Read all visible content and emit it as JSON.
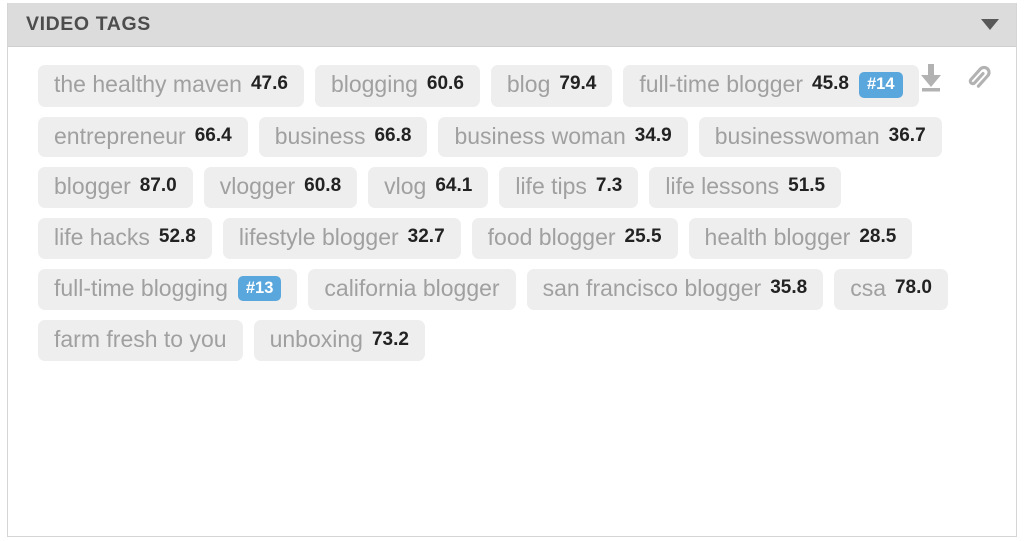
{
  "panel": {
    "title": "VIDEO TAGS",
    "collapse_icon": "chevron-down-icon",
    "collapse_state": "expanded"
  },
  "toolbar": {
    "items": [
      {
        "name": "download-icon",
        "label": "Download"
      },
      {
        "name": "paperclip-icon",
        "label": "Attach"
      }
    ]
  },
  "colors": {
    "panel_header_bg": "#dcdcdc",
    "panel_bg": "#ffffff",
    "tag_bg": "#eeeeee",
    "tag_label": "#a0a0a0",
    "tag_score": "#222222",
    "rank_badge_bg": "#5aa7dd",
    "rank_badge_text": "#ffffff",
    "border": "#d5d5d5"
  },
  "tags": [
    {
      "label": "the healthy maven",
      "score": "47.6",
      "rank": ""
    },
    {
      "label": "blogging",
      "score": "60.6",
      "rank": ""
    },
    {
      "label": "blog",
      "score": "79.4",
      "rank": ""
    },
    {
      "label": "full-time blogger",
      "score": "45.8",
      "rank": "#14"
    },
    {
      "label": "entrepreneur",
      "score": "66.4",
      "rank": ""
    },
    {
      "label": "business",
      "score": "66.8",
      "rank": ""
    },
    {
      "label": "business woman",
      "score": "34.9",
      "rank": ""
    },
    {
      "label": "businesswoman",
      "score": "36.7",
      "rank": ""
    },
    {
      "label": "blogger",
      "score": "87.0",
      "rank": ""
    },
    {
      "label": "vlogger",
      "score": "60.8",
      "rank": ""
    },
    {
      "label": "vlog",
      "score": "64.1",
      "rank": ""
    },
    {
      "label": "life tips",
      "score": "7.3",
      "rank": ""
    },
    {
      "label": "life lessons",
      "score": "51.5",
      "rank": ""
    },
    {
      "label": "life hacks",
      "score": "52.8",
      "rank": ""
    },
    {
      "label": "lifestyle blogger",
      "score": "32.7",
      "rank": ""
    },
    {
      "label": "food blogger",
      "score": "25.5",
      "rank": ""
    },
    {
      "label": "health blogger",
      "score": "28.5",
      "rank": ""
    },
    {
      "label": "full-time blogging",
      "score": "",
      "rank": "#13"
    },
    {
      "label": "california blogger",
      "score": "",
      "rank": ""
    },
    {
      "label": "san francisco blogger",
      "score": "35.8",
      "rank": ""
    },
    {
      "label": "csa",
      "score": "78.0",
      "rank": ""
    },
    {
      "label": "farm fresh to you",
      "score": "",
      "rank": ""
    },
    {
      "label": "unboxing",
      "score": "73.2",
      "rank": ""
    }
  ]
}
